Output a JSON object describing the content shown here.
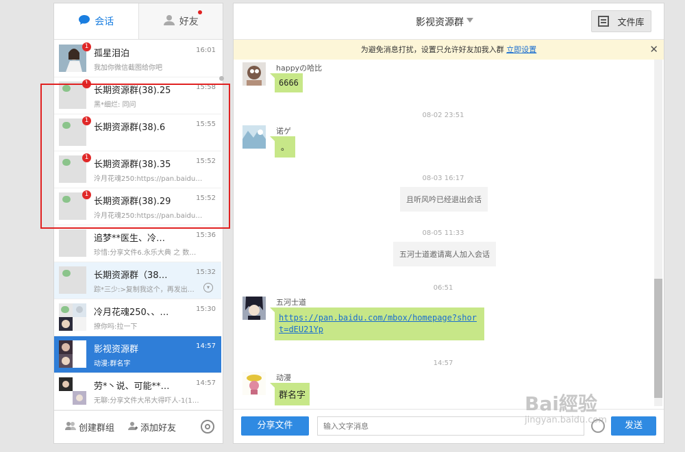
{
  "left": {
    "tabs": [
      {
        "label": "会话",
        "icon": "chat-bubble-icon"
      },
      {
        "label": "好友",
        "icon": "person-icon"
      }
    ],
    "conversations": [
      {
        "name": "孤星泪泊",
        "time": "16:01",
        "preview": "我加你微信截图给你吧",
        "badge": "1"
      },
      {
        "name": "长期资源群(38).25",
        "time": "15:58",
        "preview": "黑*细烂: 同问",
        "badge": "1"
      },
      {
        "name": "长期资源群(38).6",
        "time": "15:55",
        "preview": "",
        "badge": "1"
      },
      {
        "name": "长期资源群(38).35",
        "time": "15:52",
        "preview": "泠月花魂250:https://pan.baidu…",
        "badge": "1"
      },
      {
        "name": "长期资源群(38).29",
        "time": "15:52",
        "preview": "泠月花魂250:https://pan.baidu…",
        "badge": "1"
      },
      {
        "name": "追梦**医生、冷…",
        "time": "15:36",
        "preview": "珍惜:分享文件6.永乐大典 之 数…",
        "badge": ""
      },
      {
        "name": "长期资源群（38…",
        "time": "15:32",
        "preview": "踪*三少:>复制我这个，再发出…",
        "badge": ""
      },
      {
        "name": "冷月花魂250、、…",
        "time": "15:30",
        "preview": "撩你吗:拉一下",
        "badge": ""
      },
      {
        "name": "影视资源群",
        "time": "14:57",
        "preview": "动漫:群名字",
        "badge": ""
      },
      {
        "name": "劳*丶说、可能**…",
        "time": "14:57",
        "preview": "无聊:分享文件大吊大得吓人-1(1…",
        "badge": ""
      }
    ],
    "bottom": {
      "create_group": "创建群组",
      "add_friend": "添加好友"
    }
  },
  "right": {
    "title": "影视资源群",
    "library_label": "文件库",
    "notice": {
      "text": "为避免消息打扰，设置只允许好友加我入群 ",
      "link": "立即设置"
    },
    "messages": [
      {
        "sender": "happyの哈比",
        "text": "6666"
      },
      {
        "timestamp": "08-02 23:51"
      },
      {
        "sender": "诺ゲ",
        "text": "。"
      },
      {
        "timestamp": "08-03 16:17"
      },
      {
        "system": "且听风吟已经退出会话"
      },
      {
        "timestamp": "08-05 11:33"
      },
      {
        "system": "五河士道邀请离人加入会话"
      },
      {
        "timestamp": "06:51"
      },
      {
        "sender": "五河士道",
        "text": "https://pan.baidu.com/mbox/homepage?short=dEU21Yp"
      },
      {
        "timestamp": "14:57"
      },
      {
        "sender": "动漫",
        "text": "群名字"
      }
    ],
    "input": {
      "placeholder": "输入文字消息",
      "share_label": "分享文件",
      "send_label": "发送"
    }
  },
  "watermark": {
    "brand": "Bai經验",
    "url": "jingyan.baidu.com"
  },
  "colors": {
    "accent": "#2f7ed8",
    "bubble": "#c7e788",
    "badge": "#e02828",
    "highlight": "#e02020"
  }
}
